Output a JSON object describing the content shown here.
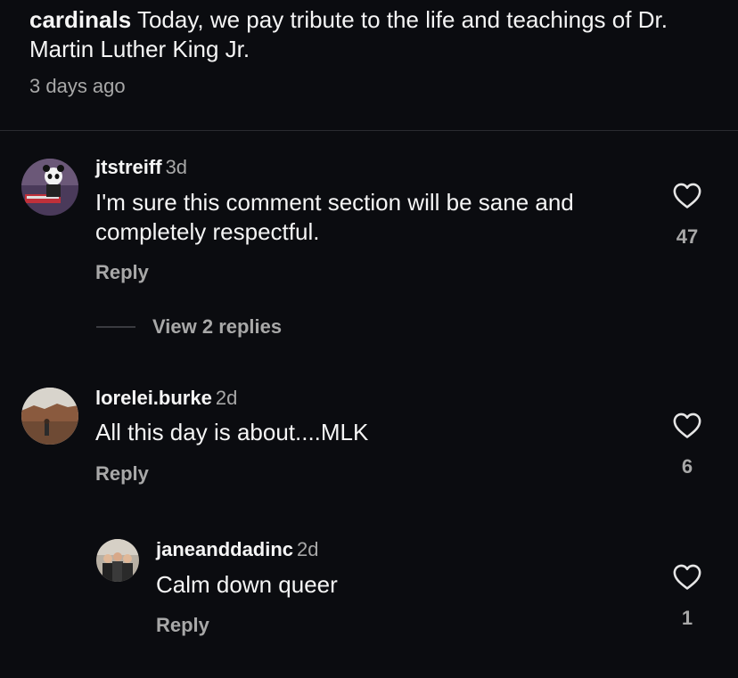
{
  "post": {
    "author": "cardinals",
    "caption": "Today, we pay tribute to the life and teachings of Dr. Martin Luther King Jr.",
    "time": "3 days ago"
  },
  "comments": [
    {
      "username": "jtstreiff",
      "time": "3d",
      "text": "I'm sure this comment section will be sane and completely respectful.",
      "reply_label": "Reply",
      "likes": "47",
      "avatar_icon": "panda-avatar-icon"
    },
    {
      "username": "lorelei.burke",
      "time": "2d",
      "text": "All this day is about....MLK",
      "reply_label": "Reply",
      "likes": "6",
      "avatar_icon": "landscape-avatar-icon"
    },
    {
      "username": "janeanddadinc",
      "time": "2d",
      "text": "Calm down queer",
      "reply_label": "Reply",
      "likes": "1",
      "avatar_icon": "group-photo-avatar-icon"
    }
  ],
  "view_replies": "View 2 replies",
  "colors": {
    "background": "#0b0c10",
    "primary_text": "#f5f5f5",
    "secondary_text": "#a8a8a8"
  }
}
